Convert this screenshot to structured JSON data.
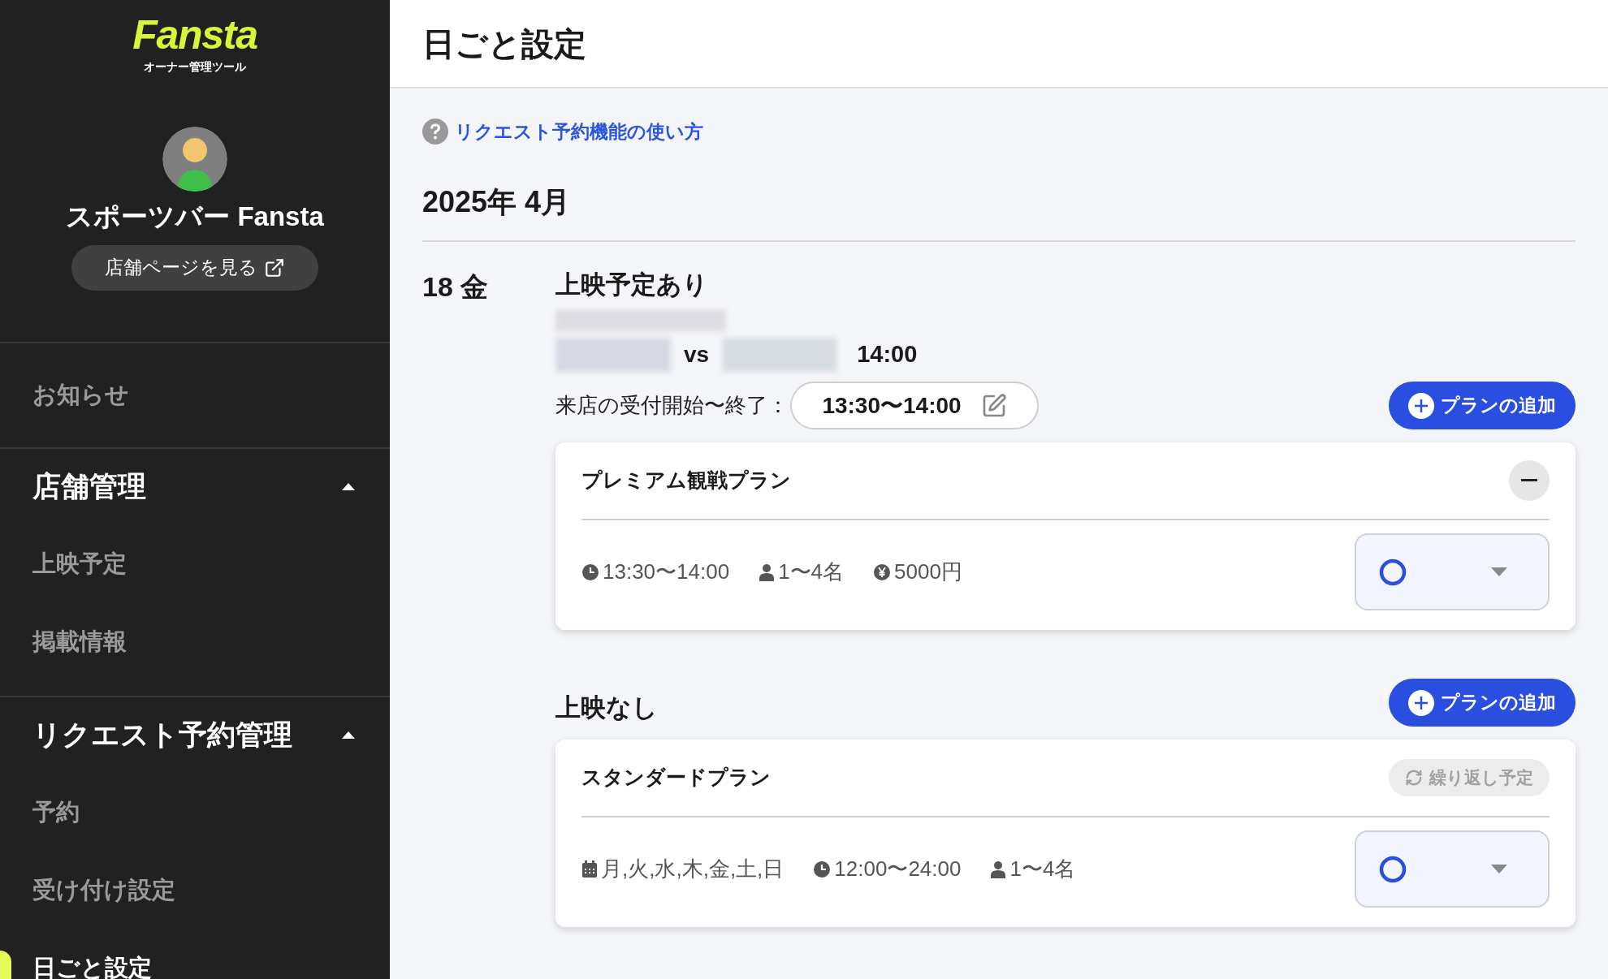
{
  "sidebar": {
    "logo": {
      "name": "Fansta",
      "subtitle": "オーナー管理ツール"
    },
    "profile": {
      "store_name": "スポーツバー Fansta",
      "view_page_button": "店舗ページを見る"
    },
    "nav": [
      {
        "kind": "item",
        "label": "お知らせ",
        "selected": false
      },
      {
        "kind": "group",
        "label": "店舗管理",
        "expanded": true,
        "children": [
          {
            "label": "上映予定",
            "selected": false
          },
          {
            "label": "掲載情報",
            "selected": false
          }
        ]
      },
      {
        "kind": "group",
        "label": "リクエスト予約管理",
        "expanded": true,
        "children": [
          {
            "label": "予約",
            "selected": false
          },
          {
            "label": "受け付け設定",
            "selected": false
          },
          {
            "label": "日ごと設定",
            "selected": true
          }
        ]
      }
    ]
  },
  "main": {
    "title": "日ごと設定",
    "help_link": "リクエスト予約機能の使い方",
    "month": "2025年 4月",
    "days": [
      {
        "date": "18 金",
        "sections": [
          {
            "heading": "上映予定あり",
            "match": {
              "vs": "vs",
              "time": "14:00"
            },
            "reception": {
              "label": "来店の受付開始〜終了：",
              "value": "13:30〜14:00"
            },
            "add_button": "プランの追加",
            "plans": [
              {
                "name": "プレミアム観戦プラン",
                "action": {
                  "kind": "collapse"
                },
                "details": [
                  {
                    "kind": "clock",
                    "text": "13:30〜14:00"
                  },
                  {
                    "kind": "person",
                    "text": "1〜4名"
                  },
                  {
                    "kind": "yen",
                    "text": "5000円"
                  }
                ]
              }
            ]
          },
          {
            "heading": "上映なし",
            "add_button": "プランの追加",
            "plans": [
              {
                "name": "スタンダードプラン",
                "action": {
                  "kind": "repeat",
                  "label": "繰り返し予定",
                  "disabled": true
                },
                "details": [
                  {
                    "kind": "calendar",
                    "text": "月,火,水,木,金,土,日"
                  },
                  {
                    "kind": "clock",
                    "text": "12:00〜24:00"
                  },
                  {
                    "kind": "person",
                    "text": "1〜4名"
                  }
                ]
              }
            ]
          }
        ]
      }
    ]
  }
}
